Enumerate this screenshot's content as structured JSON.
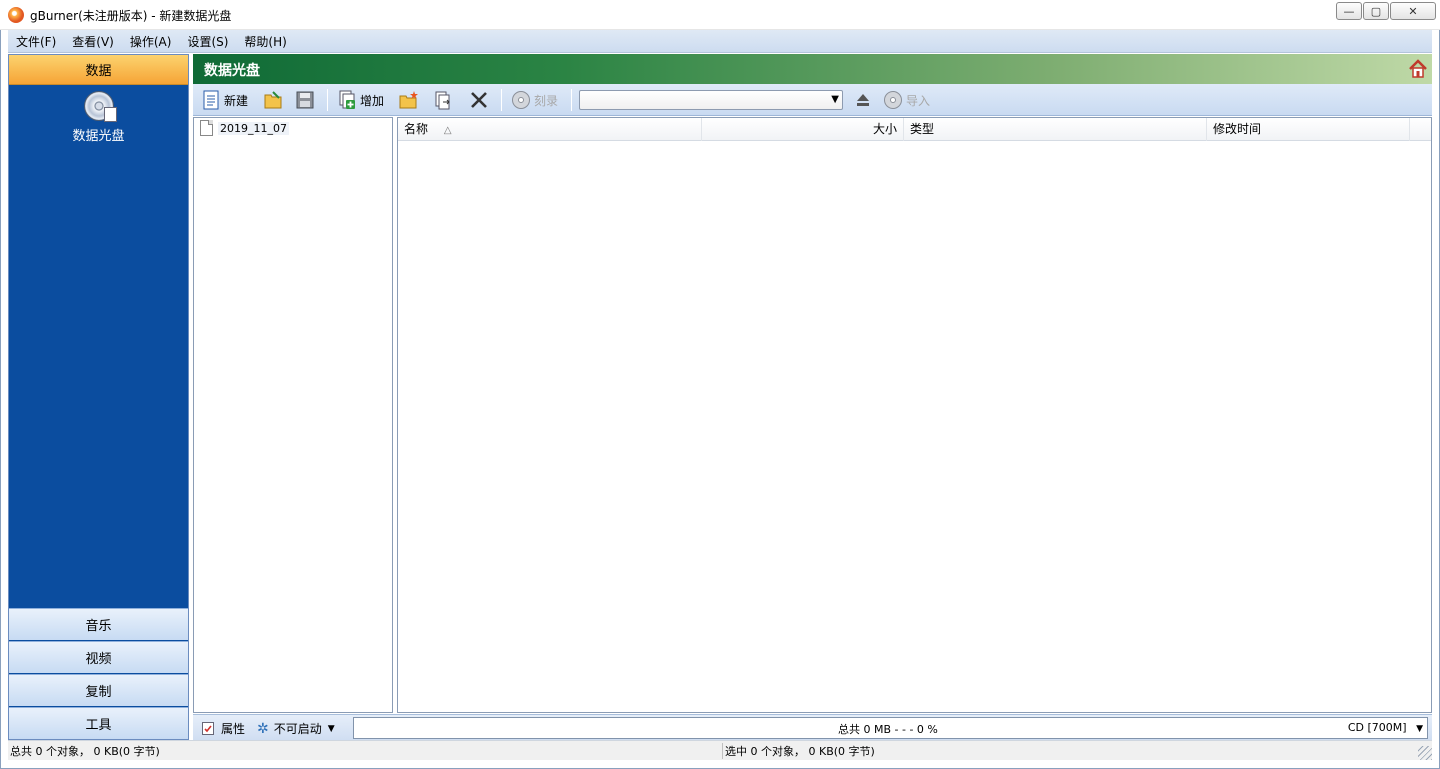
{
  "window": {
    "title": "gBurner(未注册版本) - 新建数据光盘",
    "minimize_glyph": "—",
    "maximize_glyph": "▢",
    "close_glyph": "✕"
  },
  "menu": [
    {
      "label": "文件(F)"
    },
    {
      "label": "查看(V)"
    },
    {
      "label": "操作(A)"
    },
    {
      "label": "设置(S)"
    },
    {
      "label": "帮助(H)"
    }
  ],
  "leftnav": {
    "active_section": "数据",
    "active_item": "数据光盘",
    "sections": [
      "音乐",
      "视频",
      "复制",
      "工具"
    ]
  },
  "header": {
    "title": "数据光盘",
    "home_icon": "home-icon"
  },
  "toolbar": {
    "new_label": "新建",
    "add_label": "增加",
    "burn_label": "刻录",
    "import_label": "导入",
    "drive_select_value": ""
  },
  "tree": {
    "items": [
      {
        "label": "2019_11_07"
      }
    ]
  },
  "list": {
    "columns": [
      "名称",
      "大小",
      "类型",
      "修改时间"
    ],
    "sort_glyph": "△"
  },
  "bottombar": {
    "properties_label": "属性",
    "boot_label": "不可启动",
    "capacity_text": "总共 0 MB  - - -  0 %",
    "disc_size": "CD [700M]"
  },
  "status": {
    "left": "总共 0 个对象，  0 KB(0 字节)",
    "right": "选中 0 个对象，  0 KB(0 字节)"
  }
}
